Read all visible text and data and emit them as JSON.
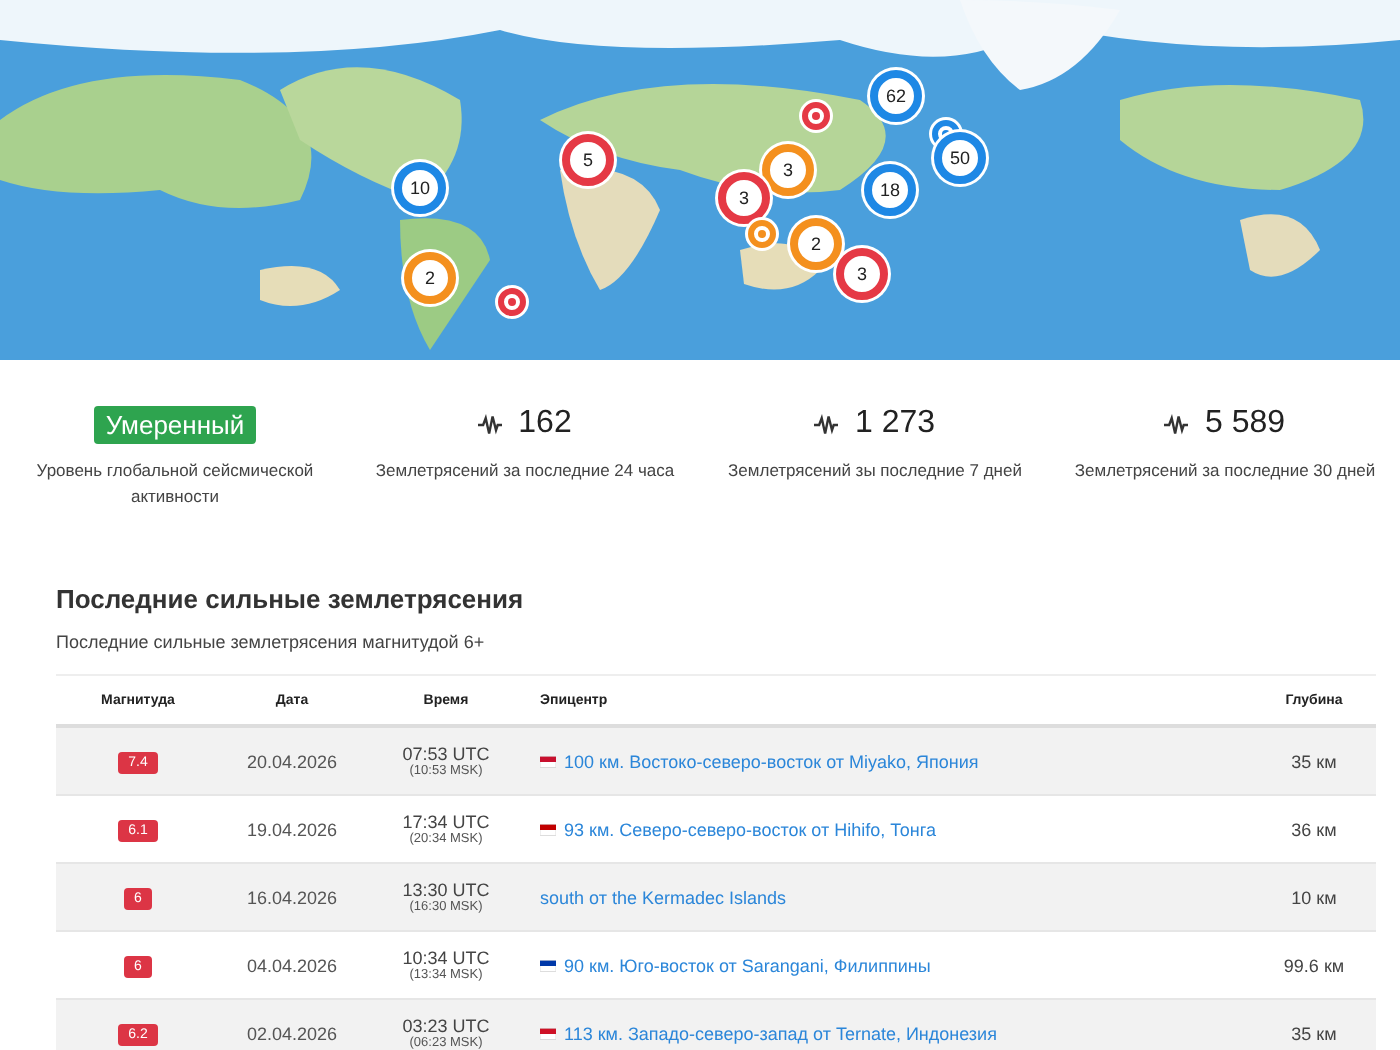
{
  "map": {
    "kind": "picture",
    "markers": [
      {
        "kind": "cluster",
        "count": "10",
        "color": "#1e88e5"
      },
      {
        "kind": "cluster",
        "count": "2",
        "color": "#f4901e"
      },
      {
        "kind": "point",
        "color": "#e53945"
      },
      {
        "kind": "cluster",
        "count": "5",
        "color": "#e53945"
      },
      {
        "kind": "point",
        "color": "#e53945"
      },
      {
        "kind": "cluster",
        "count": "62",
        "color": "#1e88e5"
      },
      {
        "kind": "point",
        "color": "#1e88e5"
      },
      {
        "kind": "cluster",
        "count": "50",
        "color": "#1e88e5"
      },
      {
        "kind": "cluster",
        "count": "3",
        "color": "#f4901e"
      },
      {
        "kind": "cluster",
        "count": "3",
        "color": "#e53945"
      },
      {
        "kind": "cluster",
        "count": "18",
        "color": "#1e88e5"
      },
      {
        "kind": "point",
        "color": "#f4901e"
      },
      {
        "kind": "cluster",
        "count": "2",
        "color": "#f4901e"
      },
      {
        "kind": "cluster",
        "count": "3",
        "color": "#e53945"
      }
    ]
  },
  "stats": [
    {
      "kind": "level",
      "value": "Умеренный",
      "label": "Уровень глобальной сейсмической активности"
    },
    {
      "kind": "count",
      "value": "162",
      "label": "Землетрясений за последние 24 часа"
    },
    {
      "kind": "count",
      "value": "1 273",
      "label": "Землетрясений зы последние 7 дней"
    },
    {
      "kind": "count",
      "value": "5 589",
      "label": "Землетрясений за последние 30 дней"
    }
  ],
  "section": {
    "title": "Последние сильные землетрясения",
    "subtitle": "Последние сильные землетрясения магнитудой 6+"
  },
  "table": {
    "columns": [
      "Магнитуда",
      "Дата",
      "Время",
      "Эпицентр",
      "Глубина"
    ],
    "rows": [
      {
        "magnitude": "7.4",
        "date": "20.04.2026",
        "time_utc": "07:53 UTC",
        "time_msk": "(10:53 MSK)",
        "flag": {
          "color": "#c8102e"
        },
        "epicenter": "100 км. Востоко-северо-восток от Miyako, Япония",
        "depth": "35 км"
      },
      {
        "magnitude": "6.1",
        "date": "19.04.2026",
        "time_utc": "17:34 UTC",
        "time_msk": "(20:34 MSK)",
        "flag": {
          "color": "#c10000"
        },
        "epicenter": "93 км. Северо-северо-восток от Hihifo, Тонга",
        "depth": "36 км"
      },
      {
        "magnitude": "6",
        "date": "16.04.2026",
        "time_utc": "13:30 UTC",
        "time_msk": "(16:30 MSK)",
        "epicenter": "south от the Kermadec Islands",
        "depth": "10 км"
      },
      {
        "magnitude": "6",
        "date": "04.04.2026",
        "time_utc": "10:34 UTC",
        "time_msk": "(13:34 MSK)",
        "flag": {
          "color": "#0038a8"
        },
        "epicenter": "90 км. Юго-восток от Sarangani, Филиппины",
        "depth": "99.6 км"
      },
      {
        "magnitude": "6.2",
        "date": "02.04.2026",
        "time_utc": "03:23 UTC",
        "time_msk": "(06:23 MSK)",
        "flag": {
          "color": "#ce1126"
        },
        "epicenter": "113 км. Западо-северо-запад от Ternate, Индонезия",
        "depth": "35 км"
      }
    ]
  }
}
